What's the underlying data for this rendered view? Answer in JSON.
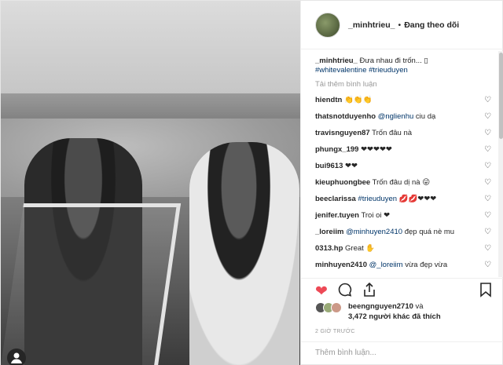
{
  "header": {
    "username": "_minhtrieu_",
    "separator": "•",
    "follow_status": "Đang theo dõi"
  },
  "caption": {
    "username": "_minhtrieu_",
    "text": "Đưa nhau đi trốn... ▯",
    "hashtags": "#whitevalentine #trieuduyen"
  },
  "load_more": "Tải thêm bình luận",
  "comments": [
    {
      "user": "hiendtn",
      "text": "👏👏👏"
    },
    {
      "user": "thatsnotduyenho",
      "mention": "@nglienhu",
      "text": "ciu dạ"
    },
    {
      "user": "travisnguyen87",
      "text": "Trốn đâu nà"
    },
    {
      "user": "phungx_199",
      "text": "❤❤❤❤❤"
    },
    {
      "user": "bui9613",
      "text": "❤❤"
    },
    {
      "user": "kieuphuongbee",
      "text": "Trốn đâu dị nà 😜"
    },
    {
      "user": "beeclarissa",
      "mention": "#trieuduyen",
      "text": "💋💋❤❤❤"
    },
    {
      "user": "jenifer.tuyen",
      "text": "Troi oi ❤"
    },
    {
      "user": "_loreiim",
      "mention": "@minhuyen2410",
      "text": "đẹp quá nè mu"
    },
    {
      "user": "0313.hp",
      "text": "Great ✋"
    },
    {
      "user": "minhuyen2410",
      "mention": "@_loreiim",
      "text": "vừa đẹp vừa"
    }
  ],
  "icons": {
    "like": "❤",
    "comment": "◯",
    "share": "⇪",
    "save": "🔖",
    "comment_like": "♡"
  },
  "likes": {
    "first_user": "beengnguyen2710",
    "connector": "và",
    "others": "3,472 người khác đã thích"
  },
  "timestamp": "2 GIỜ TRƯỚC",
  "add_comment_placeholder": "Thêm bình luận...",
  "colors": {
    "like_red": "#ed4956",
    "link_blue": "#003569"
  }
}
